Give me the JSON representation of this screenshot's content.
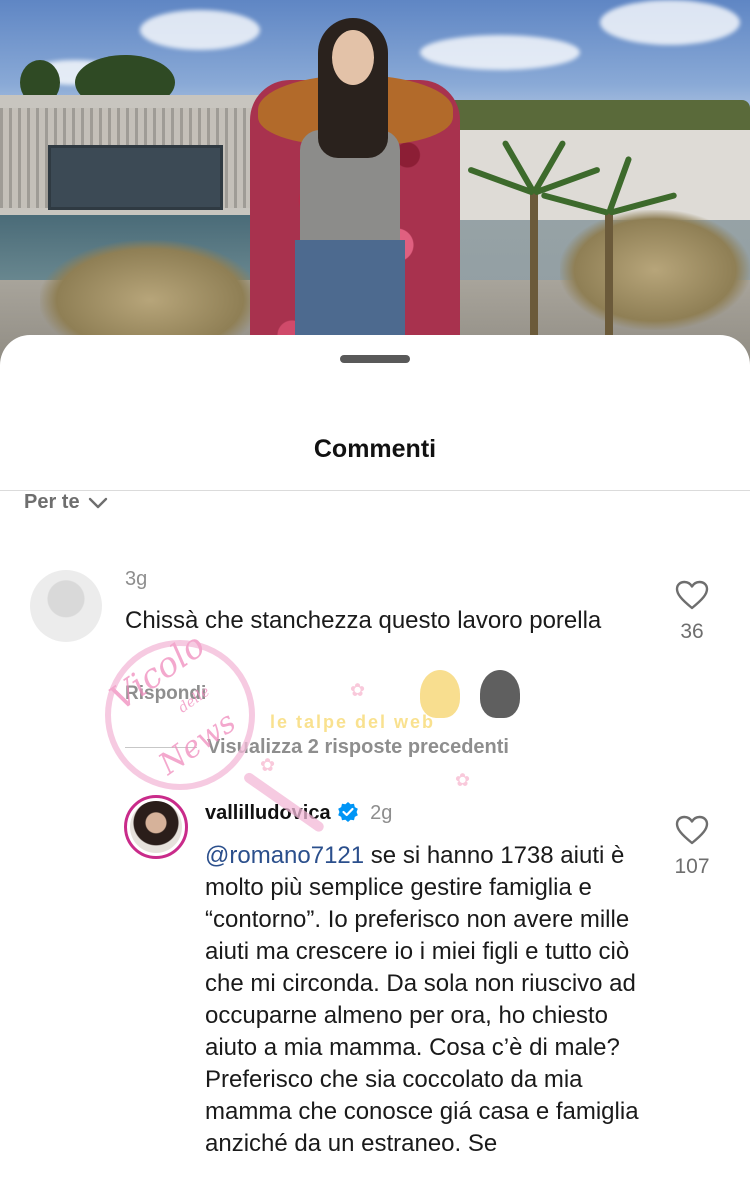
{
  "sheet": {
    "title": "Commenti",
    "filter_label": "Per te"
  },
  "comments": [
    {
      "username": "",
      "time": "3g",
      "text": "Chissà che stanchezza questo lavoro porella",
      "reply_label": "Rispondi",
      "likes": "36",
      "view_previous_replies": "Visualizza 2 risposte precedenti"
    },
    {
      "username": "vallilludovica",
      "verified": true,
      "time": "2g",
      "mention": "@romano7121",
      "text": " se si hanno 1738 aiuti è molto più semplice gestire famiglia e “contorno”. Io preferisco non avere mille aiuti ma crescere io i miei figli e tutto ciò che mi circonda. Da sola non riuscivo ad occuparne almeno per ora, ho chiesto aiuto a mia mamma. Cosa c’è di male? Preferisco che sia coccolato da mia mamma che conosce giá casa e famiglia anziché da un estraneo. Se",
      "likes": "107"
    }
  ],
  "watermark": {
    "script_line1": "Vicolo",
    "script_line2": "delle",
    "script_line3": "News",
    "banner": "le talpe del web"
  },
  "colors": {
    "mention": "#2b4f8c",
    "verified": "#0095f6",
    "muted": "#8e8e8e"
  },
  "icons": [
    "chevron-down-icon",
    "heart-outline-icon",
    "verified-badge-icon",
    "drag-handle"
  ]
}
